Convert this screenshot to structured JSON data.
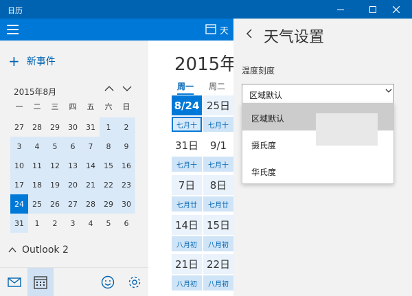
{
  "app": {
    "title": "日历"
  },
  "topbar": {
    "label": "天"
  },
  "sidebar": {
    "new_event": "新事件",
    "mini_cal": {
      "month_label": "2015年8月",
      "weekdays": [
        "一",
        "二",
        "三",
        "四",
        "五",
        "六",
        "日"
      ],
      "days": [
        "27",
        "28",
        "29",
        "30",
        "31",
        "1",
        "2",
        "3",
        "4",
        "5",
        "6",
        "7",
        "8",
        "9",
        "10",
        "11",
        "12",
        "13",
        "14",
        "15",
        "16",
        "17",
        "18",
        "19",
        "20",
        "21",
        "22",
        "23",
        "24",
        "25",
        "26",
        "27",
        "28",
        "29",
        "30",
        "31",
        "1",
        "2",
        "3",
        "4",
        "5",
        "6"
      ],
      "selected_day": "24"
    },
    "account": "Outlook 2"
  },
  "main": {
    "month_title": "2015年8月",
    "weekdays": [
      "周一",
      "周二"
    ],
    "rows": [
      {
        "dates": [
          "8/24",
          "25日"
        ],
        "lunar": [
          "七月十",
          "七月十"
        ]
      },
      {
        "dates": [
          "31日",
          "9/1"
        ],
        "lunar": [
          "七月十",
          "七月十"
        ]
      },
      {
        "dates": [
          "7日",
          "8日"
        ],
        "lunar": [
          "七月廿",
          "七月廿"
        ]
      },
      {
        "dates": [
          "14日",
          "15日"
        ],
        "lunar": [
          "八月初",
          "八月初"
        ]
      },
      {
        "dates": [
          "21日",
          "22日"
        ],
        "lunar": [
          "八月初",
          "八月初"
        ]
      }
    ]
  },
  "weather_panel": {
    "title": "天气设置",
    "temp_label": "温度刻度",
    "selected": "区域默认",
    "options": [
      "区域默认",
      "摄氏度",
      "华氏度"
    ]
  },
  "colors": {
    "titlebar": "#0063B1",
    "accent": "#0078D7",
    "panel_bg": "#F2F2F2"
  }
}
